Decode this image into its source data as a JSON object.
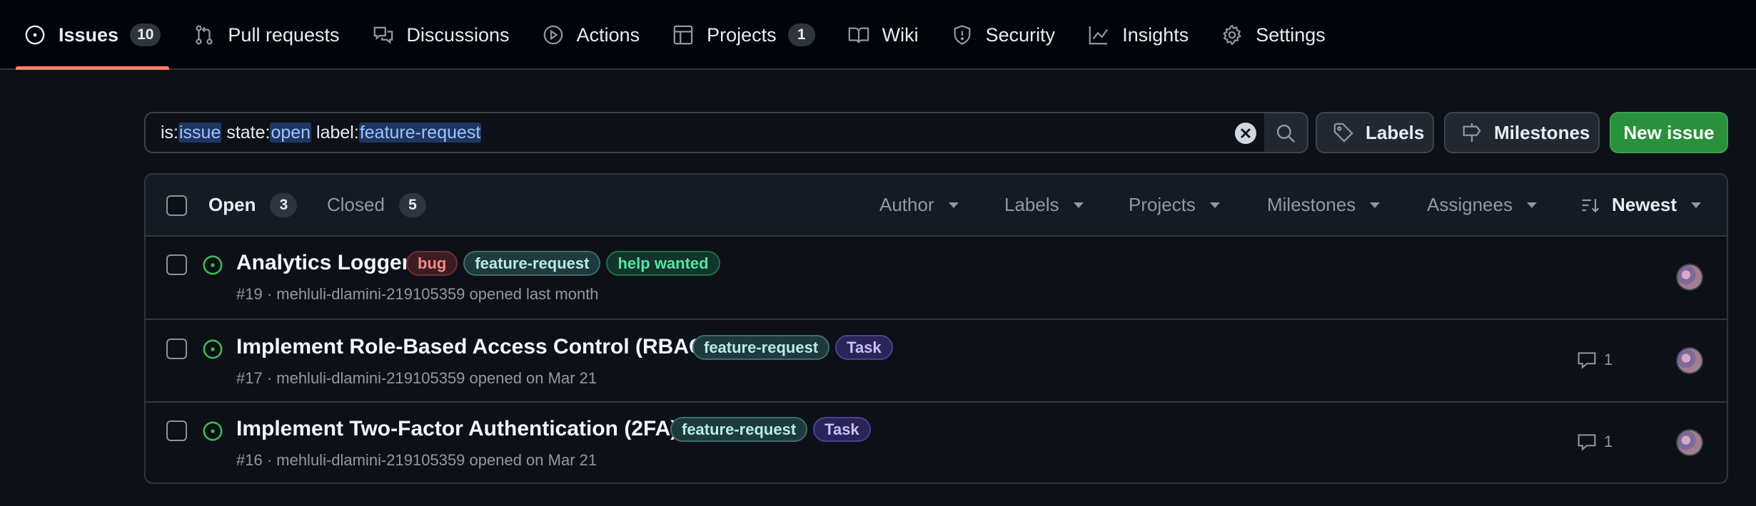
{
  "nav": {
    "tabs": [
      {
        "label": "Issues",
        "count": "10",
        "icon": "issue-opened-icon",
        "selected": true
      },
      {
        "label": "Pull requests",
        "icon": "git-pull-request-icon"
      },
      {
        "label": "Discussions",
        "icon": "comment-discussion-icon"
      },
      {
        "label": "Actions",
        "icon": "play-icon"
      },
      {
        "label": "Projects",
        "count": "1",
        "icon": "table-icon"
      },
      {
        "label": "Wiki",
        "icon": "book-icon"
      },
      {
        "label": "Security",
        "icon": "shield-icon"
      },
      {
        "label": "Insights",
        "icon": "graph-icon"
      },
      {
        "label": "Settings",
        "icon": "gear-icon"
      }
    ]
  },
  "search": {
    "is_prefix": "is:",
    "is_value": "issue",
    "state_prefix": " state:",
    "state_value": "open",
    "label_prefix": " label:",
    "label_value": "feature-request"
  },
  "actions": {
    "labels": "Labels",
    "milestones": "Milestones",
    "new_issue": "New issue"
  },
  "list": {
    "open_label": "Open",
    "open_count": "3",
    "closed_label": "Closed",
    "closed_count": "5",
    "filters": [
      "Author",
      "Labels",
      "Projects",
      "Milestones",
      "Assignees"
    ],
    "sort": "Newest"
  },
  "issues": [
    {
      "title": "Analytics Logger",
      "labels": [
        "bug",
        "feature-request",
        "help wanted"
      ],
      "meta": "#19 · mehluli-dlamini-219105359 opened last month",
      "comments": ""
    },
    {
      "title": "Implement Role-Based Access Control (RBAC)",
      "labels": [
        "feature-request",
        "Task"
      ],
      "meta": "#17 · mehluli-dlamini-219105359 opened on Mar 21",
      "comments": "1"
    },
    {
      "title": "Implement Two-Factor Authentication (2FA)",
      "labels": [
        "feature-request",
        "Task"
      ],
      "meta": "#16 · mehluli-dlamini-219105359 opened on Mar 21",
      "comments": "1"
    }
  ],
  "colors": {
    "background": "#0d1117",
    "nav_background": "#010409",
    "selected_underline": "#f78166",
    "new_issue_button": "#29903b",
    "open_issue_icon": "#3fb950",
    "query_highlight": "#9cc2ff"
  }
}
